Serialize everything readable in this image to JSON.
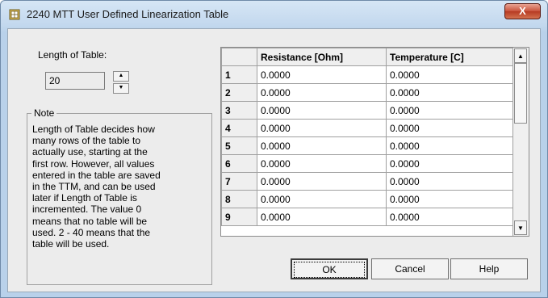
{
  "window": {
    "title": "2240 MTT User Defined Linearization Table",
    "close_label": "X",
    "icon": "table-icon"
  },
  "length": {
    "label": "Length of Table:",
    "value": "20"
  },
  "note": {
    "legend": "Note",
    "lines": [
      "Length of Table decides how",
      "many rows of the table to",
      "actually use, starting at the",
      "first row. However, all values",
      "entered in the table are saved",
      "in the TTM, and can be used",
      "later if Length of Table is",
      "incremented. The value 0",
      "means that no table will be",
      "used. 2 - 40 means that the",
      "table will be used."
    ]
  },
  "grid": {
    "columns": [
      "Resistance [Ohm]",
      "Temperature [C]"
    ],
    "rows": [
      {
        "index": "1",
        "resistance": "0.0000",
        "temperature": "0.0000"
      },
      {
        "index": "2",
        "resistance": "0.0000",
        "temperature": "0.0000"
      },
      {
        "index": "3",
        "resistance": "0.0000",
        "temperature": "0.0000"
      },
      {
        "index": "4",
        "resistance": "0.0000",
        "temperature": "0.0000"
      },
      {
        "index": "5",
        "resistance": "0.0000",
        "temperature": "0.0000"
      },
      {
        "index": "6",
        "resistance": "0.0000",
        "temperature": "0.0000"
      },
      {
        "index": "7",
        "resistance": "0.0000",
        "temperature": "0.0000"
      },
      {
        "index": "8",
        "resistance": "0.0000",
        "temperature": "0.0000"
      },
      {
        "index": "9",
        "resistance": "0.0000",
        "temperature": "0.0000"
      }
    ]
  },
  "buttons": {
    "ok": "OK",
    "cancel": "Cancel",
    "help": "Help"
  }
}
